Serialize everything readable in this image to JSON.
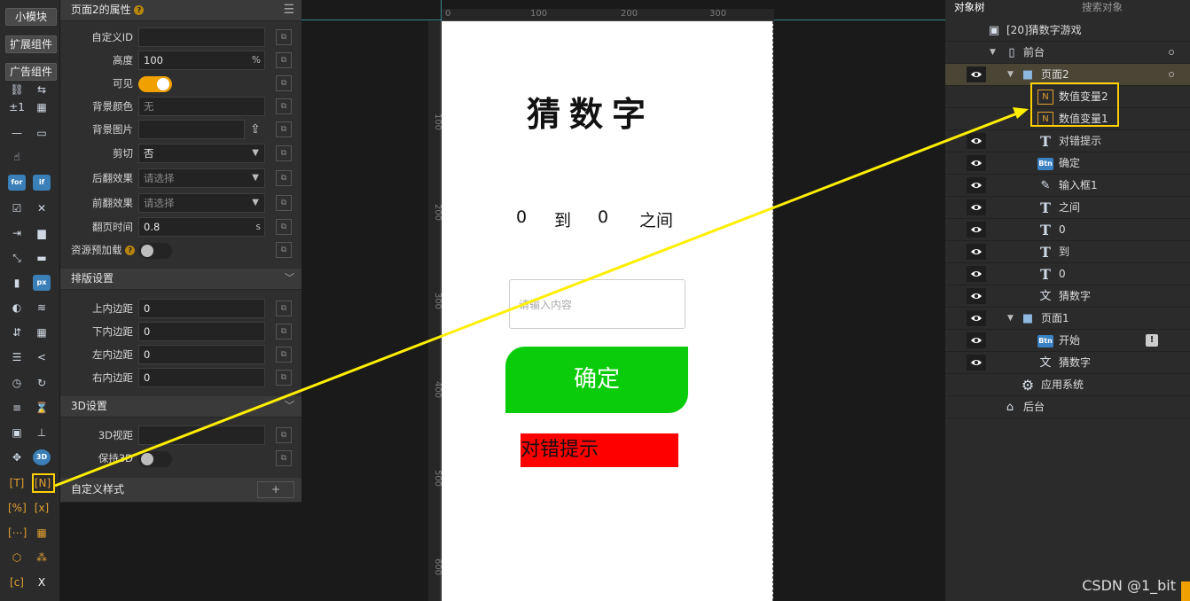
{
  "toolbar": {
    "small_module": "小模块",
    "extension": "扩展组件",
    "ad": "广告组件"
  },
  "props": {
    "title": "页面2的属性",
    "fields": {
      "custom_id": {
        "label": "自定义ID",
        "value": ""
      },
      "height": {
        "label": "高度",
        "value": "100",
        "unit": "%"
      },
      "visible": {
        "label": "可见"
      },
      "bg_color": {
        "label": "背景颜色",
        "value": "无"
      },
      "bg_image": {
        "label": "背景图片",
        "value": ""
      },
      "clip": {
        "label": "剪切",
        "value": "否"
      },
      "back_flip": {
        "label": "后翻效果",
        "placeholder": "请选择"
      },
      "front_flip": {
        "label": "前翻效果",
        "placeholder": "请选择"
      },
      "flip_time": {
        "label": "翻页时间",
        "value": "0.8",
        "unit": "s"
      },
      "preload": {
        "label": "资源预加载"
      }
    },
    "layout_section": "排版设置",
    "padding": {
      "top": {
        "label": "上内边距",
        "value": "0"
      },
      "bottom": {
        "label": "下内边距",
        "value": "0"
      },
      "left": {
        "label": "左内边距",
        "value": "0"
      },
      "right": {
        "label": "右内边距",
        "value": "0"
      }
    },
    "section_3d": "3D设置",
    "view_3d": {
      "label": "3D视距",
      "value": ""
    },
    "keep_3d": {
      "label": "保持3D"
    },
    "custom_style": "自定义样式",
    "add": "+"
  },
  "ruler": {
    "top": [
      "0",
      "100",
      "200",
      "300"
    ],
    "left": [
      "100",
      "200",
      "300",
      "400",
      "500",
      "600"
    ]
  },
  "phone": {
    "title": "猜数字",
    "range": {
      "low": "0",
      "to": "到",
      "high": "0",
      "between": "之间"
    },
    "input_placeholder": "请输入内容",
    "ok_button": "确定",
    "hint": "对错提示"
  },
  "tree": {
    "tab_objects": "对象树",
    "tab_search": "搜索对象",
    "root": "[20]猜数字游戏",
    "front": "前台",
    "page2": "页面2",
    "var2": "数值变量2",
    "var1": "数值变量1",
    "hint": "对错提示",
    "confirm": "确定",
    "input1": "输入框1",
    "between": "之间",
    "zero_a": "0",
    "to": "到",
    "zero_b": "0",
    "guess_title": "猜数字",
    "page1": "页面1",
    "start": "开始",
    "guess_title_p1": "猜数字",
    "app_system": "应用系统",
    "backstage": "后台"
  },
  "watermark": "CSDN @1_bit",
  "colors": {
    "accent": "#f0a000",
    "highlight": "#ffd000",
    "ok_green": "#0bcc0b",
    "hint_red": "#ff0000"
  }
}
